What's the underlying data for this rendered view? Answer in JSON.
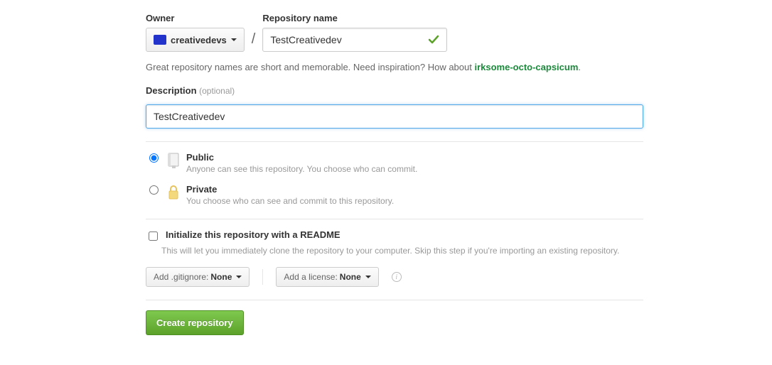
{
  "owner": {
    "label": "Owner",
    "name": "creativedevs"
  },
  "repo": {
    "label": "Repository name",
    "value": "TestCreativedev"
  },
  "hint": {
    "text_before": "Great repository names are short and memorable. Need inspiration? How about ",
    "suggestion": "irksome-octo-capsicum",
    "text_after": "."
  },
  "description": {
    "label": "Description",
    "optional": "(optional)",
    "value": "TestCreativedev"
  },
  "visibility": {
    "public": {
      "title": "Public",
      "sub": "Anyone can see this repository. You choose who can commit."
    },
    "private": {
      "title": "Private",
      "sub": "You choose who can see and commit to this repository."
    }
  },
  "init": {
    "label": "Initialize this repository with a README",
    "sub": "This will let you immediately clone the repository to your computer. Skip this step if you're importing an existing repository."
  },
  "gitignore": {
    "prefix": "Add .gitignore:",
    "value": "None"
  },
  "license": {
    "prefix": "Add a license:",
    "value": "None"
  },
  "submit": {
    "label": "Create repository"
  }
}
